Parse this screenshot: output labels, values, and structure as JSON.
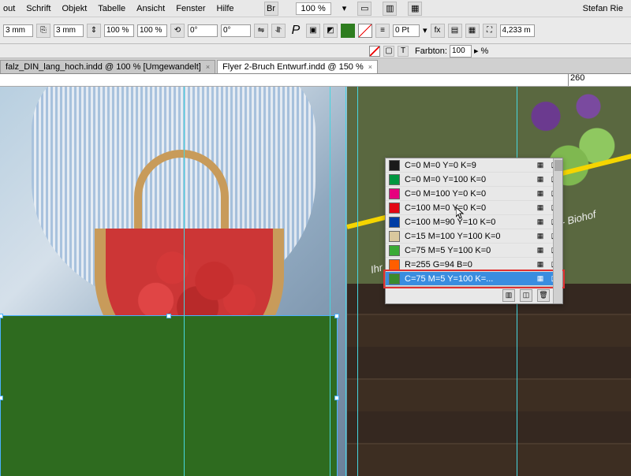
{
  "menu": {
    "items": [
      "out",
      "Schrift",
      "Objekt",
      "Tabelle",
      "Ansicht",
      "Fenster",
      "Hilfe"
    ],
    "zoom": "100 %",
    "user": "Stefan Rie"
  },
  "ctrl": {
    "coord1": "3 mm",
    "coord2": "3 mm",
    "scale1": "100 %",
    "scale2": "100 %",
    "rot": "0°",
    "shear": "0°",
    "stroke": "0 Pt",
    "farb_label": "Farbton:",
    "farb_val": "100",
    "farb_unit": "%",
    "xval": "4,233 m"
  },
  "tabs": [
    {
      "label": "falz_DIN_lang_hoch.indd @ 100 % [Umgewandelt]",
      "active": false
    },
    {
      "label": "Flyer 2-Bruch Entwurf.indd @ 150 %",
      "active": true
    }
  ],
  "ruler": {
    "ticks": [
      {
        "pos": 720,
        "val": "260"
      }
    ]
  },
  "swatches": {
    "rows": [
      {
        "color": "#1a1a1a",
        "name": "C=0 M=0 Y=0 K=9"
      },
      {
        "color": "#009640",
        "name": "C=0 M=0 Y=100 K=0"
      },
      {
        "color": "#e6007e",
        "name": "C=0 M=100 Y=0 K=0"
      },
      {
        "color": "#e30613",
        "name": "C=100 M=0 Y=0 K=0"
      },
      {
        "color": "#003da5",
        "name": "C=100 M=90 Y=10 K=0"
      },
      {
        "color": "#d9c89e",
        "name": "C=15 M=100 Y=100 K=0"
      },
      {
        "color": "#3aaa35",
        "name": "C=75 M=5 Y=100 K=0"
      },
      {
        "color": "#ff5e00",
        "name": "R=255 G=94 B=0"
      },
      {
        "color": "#3a8b2e",
        "name": "C=75 M=5 Y=100 K=...",
        "sel": true
      }
    ]
  },
  "tagline": "Ihr Hof für spezielle Waren aus der Region  -  Biohof"
}
